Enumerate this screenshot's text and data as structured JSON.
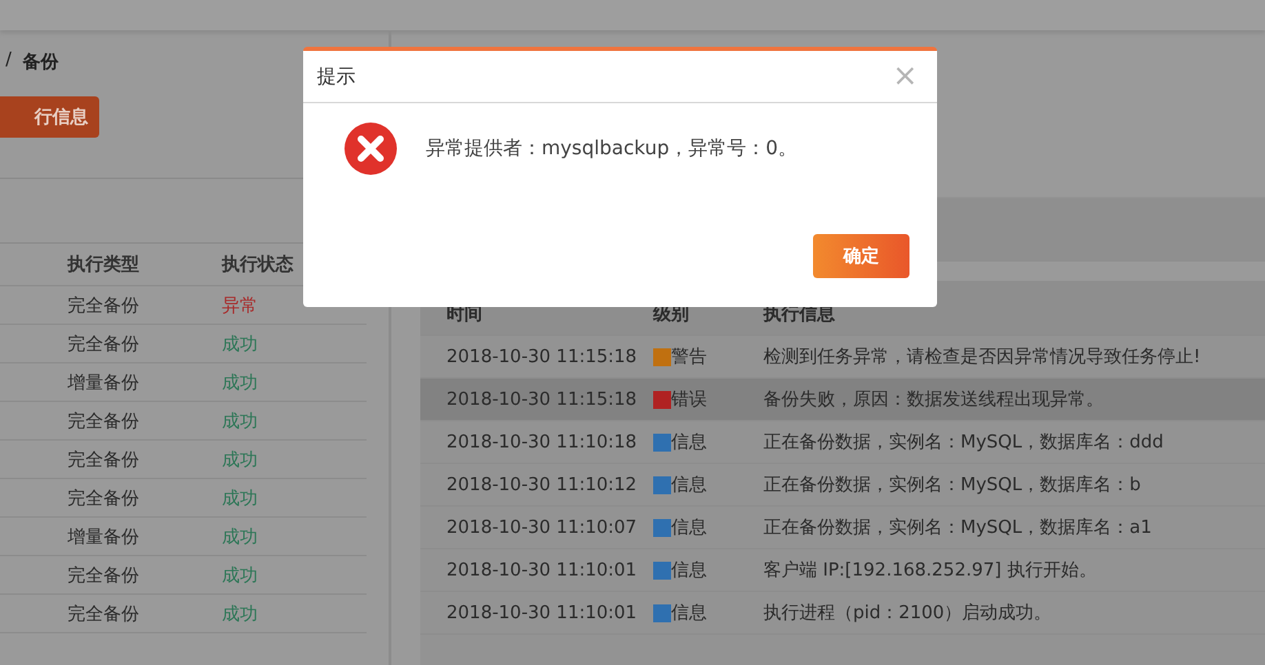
{
  "breadcrumb": {
    "separator": "/",
    "current": "备份"
  },
  "action_button": "行信息",
  "backup_table": {
    "columns": [
      "执行类型",
      "执行状态"
    ],
    "rows": [
      {
        "type": "完全备份",
        "status": "异常",
        "color": "#a82a2a"
      },
      {
        "type": "完全备份",
        "status": "成功",
        "color": "#2c7656"
      },
      {
        "type": "增量备份",
        "status": "成功",
        "color": "#2c7656"
      },
      {
        "type": "完全备份",
        "status": "成功",
        "color": "#2c7656"
      },
      {
        "type": "完全备份",
        "status": "成功",
        "color": "#2c7656"
      },
      {
        "type": "完全备份",
        "status": "成功",
        "color": "#2c7656"
      },
      {
        "type": "增量备份",
        "status": "成功",
        "color": "#2c7656"
      },
      {
        "type": "完全备份",
        "status": "成功",
        "color": "#2c7656"
      },
      {
        "type": "完全备份",
        "status": "成功",
        "color": "#2c7656"
      }
    ]
  },
  "log_table": {
    "columns": [
      "时间",
      "级别",
      "执行信息"
    ],
    "rows": [
      {
        "time": "2018-10-30 11:15:18",
        "level": "警告",
        "color": "#c07010",
        "message": "检测到任务异常，请检查是否因异常情况导致任务停止!",
        "selected": false
      },
      {
        "time": "2018-10-30 11:15:18",
        "level": "错误",
        "color": "#b02222",
        "message": "备份失败，原因：数据发送线程出现异常。",
        "selected": true
      },
      {
        "time": "2018-10-30 11:10:18",
        "level": "信息",
        "color": "#2f70b0",
        "message": "正在备份数据，实例名：MySQL，数据库名：ddd",
        "selected": false
      },
      {
        "time": "2018-10-30 11:10:12",
        "level": "信息",
        "color": "#2f70b0",
        "message": "正在备份数据，实例名：MySQL，数据库名：b",
        "selected": false
      },
      {
        "time": "2018-10-30 11:10:07",
        "level": "信息",
        "color": "#2f70b0",
        "message": "正在备份数据，实例名：MySQL，数据库名：a1",
        "selected": false
      },
      {
        "time": "2018-10-30 11:10:01",
        "level": "信息",
        "color": "#2f70b0",
        "message": "客户端 IP:[192.168.252.97] 执行开始。",
        "selected": false
      },
      {
        "time": "2018-10-30 11:10:01",
        "level": "信息",
        "color": "#2f70b0",
        "message": "执行进程（pid：2100）启动成功。",
        "selected": false
      }
    ]
  },
  "dialog": {
    "title": "提示",
    "close": "×",
    "message": "异常提供者：mysqlbackup，异常号：0。",
    "button": "确定"
  }
}
